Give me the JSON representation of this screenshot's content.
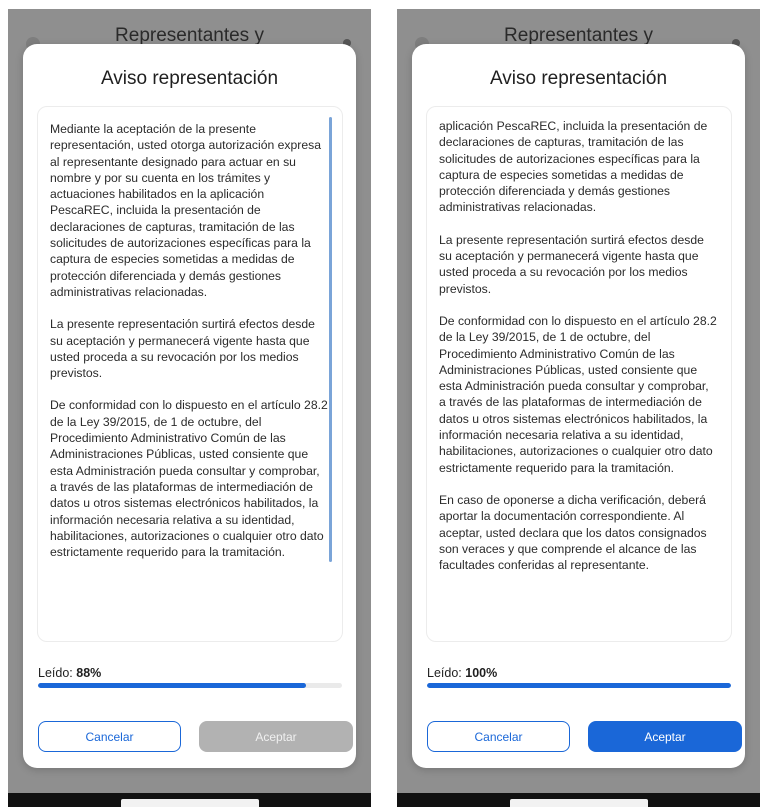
{
  "screens": [
    {
      "background_title": "Representantes y",
      "modal_title": "Aviso representación",
      "paragraphs": [
        "Mediante la aceptación de la presente representación, usted otorga autorización expresa al representante designado para actuar en su nombre y por su cuenta en los trámites y actuaciones habilitados en la aplicación PescaREC, incluida la presentación de declaraciones de capturas, tramitación de las solicitudes de autorizaciones específicas para la captura de especies sometidas a medidas de protección diferenciada y demás gestiones administrativas relacionadas.",
        "La presente representación surtirá efectos desde su aceptación y permanecerá vigente hasta que usted proceda a su revocación por los medios previstos.",
        "De conformidad con lo dispuesto en el artículo 28.2 de la Ley 39/2015, de 1 de octubre, del Procedimiento Administrativo Común de las Administraciones Públicas, usted consiente que esta Administración pueda consultar y comprobar, a través de las plataformas de intermediación de datos u otros sistemas electrónicos habilitados, la información necesaria relativa a su identidad, habilitaciones, autorizaciones o cualquier otro dato estrictamente requerido para la tramitación."
      ],
      "progress_label": "Leído:",
      "progress_value": "88%",
      "progress_fraction": 0.88,
      "cancel_label": "Cancelar",
      "accept_label": "Aceptar",
      "accept_enabled": false
    },
    {
      "background_title": "Representantes y",
      "modal_title": "Aviso representación",
      "paragraphs": [
        "aplicación PescaREC, incluida la presentación de declaraciones de capturas, tramitación de las solicitudes de autorizaciones específicas para la captura de especies sometidas a medidas de protección diferenciada y demás gestiones administrativas relacionadas.",
        "La presente representación surtirá efectos desde su aceptación y permanecerá vigente hasta que usted proceda a su revocación por los medios previstos.",
        "De conformidad con lo dispuesto en el artículo 28.2 de la Ley 39/2015, de 1 de octubre, del Procedimiento Administrativo Común de las Administraciones Públicas, usted consiente que esta Administración pueda consultar y comprobar, a través de las plataformas de intermediación de datos u otros sistemas electrónicos habilitados, la información necesaria relativa a su identidad, habilitaciones, autorizaciones o cualquier otro dato estrictamente requerido para la tramitación.",
        "En caso de oponerse a dicha verificación, deberá aportar la documentación correspondiente. Al aceptar, usted declara que los datos consignados son veraces y que comprende el alcance de las facultades conferidas al representante."
      ],
      "progress_label": "Leído:",
      "progress_value": "100%",
      "progress_fraction": 1.0,
      "cancel_label": "Cancelar",
      "accept_label": "Aceptar",
      "accept_enabled": true
    }
  ],
  "colors": {
    "accent": "#1a67d8",
    "disabled_button": "#b2b2b2",
    "overlay": "#8f8f8f"
  }
}
